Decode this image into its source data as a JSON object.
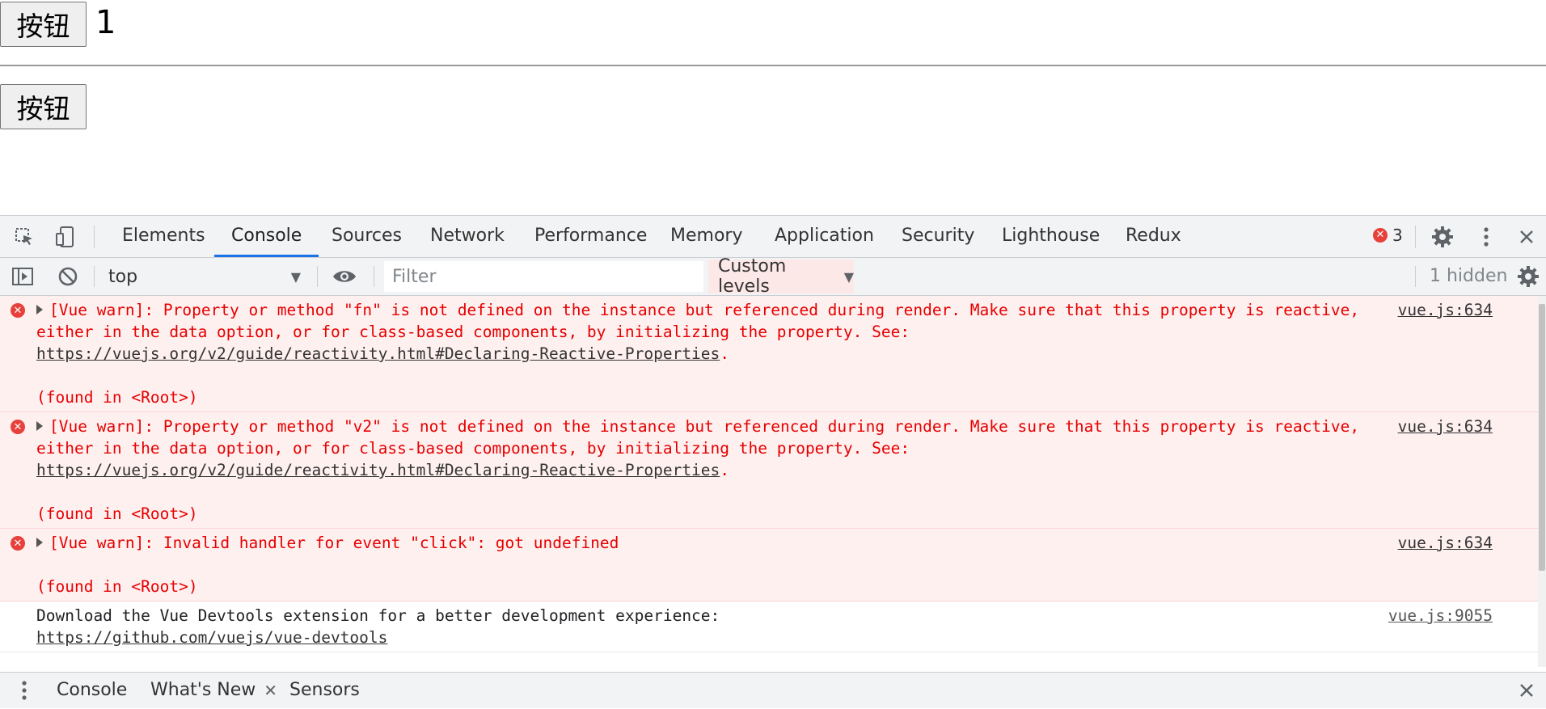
{
  "page": {
    "button1_label": "按钮",
    "value_text": "1",
    "button2_label": "按钮"
  },
  "devtools": {
    "tabs": [
      {
        "label": "Elements"
      },
      {
        "label": "Console"
      },
      {
        "label": "Sources"
      },
      {
        "label": "Network"
      },
      {
        "label": "Performance"
      },
      {
        "label": "Memory"
      },
      {
        "label": "Application"
      },
      {
        "label": "Security"
      },
      {
        "label": "Lighthouse"
      },
      {
        "label": "Redux"
      }
    ],
    "active_tab": "Console",
    "error_count": "3",
    "accent_color": "#1a73e8",
    "error_color": "#e60000"
  },
  "console_toolbar": {
    "context": "top",
    "filter_placeholder": "Filter",
    "levels_label": "Custom levels",
    "hidden_label": "1 hidden"
  },
  "messages": [
    {
      "level": "error",
      "text": "[Vue warn]: Property or method \"fn\" is not defined on the instance but referenced during render. Make sure that this property is reactive, either in the data option, or for class-based components, by initializing the property. See: ",
      "link": "https://vuejs.org/v2/guide/reactivity.html#Declaring-Reactive-Properties",
      "link_trail": ".",
      "found": "(found in <Root>)",
      "source": "vue.js:634"
    },
    {
      "level": "error",
      "text": "[Vue warn]: Property or method \"v2\" is not defined on the instance but referenced during render. Make sure that this property is reactive, either in the data option, or for class-based components, by initializing the property. See: ",
      "link": "https://vuejs.org/v2/guide/reactivity.html#Declaring-Reactive-Properties",
      "link_trail": ".",
      "found": "(found in <Root>)",
      "source": "vue.js:634"
    },
    {
      "level": "error",
      "text": "[Vue warn]: Invalid handler for event \"click\": got undefined",
      "found": "(found in <Root>)",
      "source": "vue.js:634"
    },
    {
      "level": "info",
      "text": "Download the Vue Devtools extension for a better development experience:",
      "link": "https://github.com/vuejs/vue-devtools",
      "source": "vue.js:9055"
    }
  ],
  "drawer": {
    "tabs": [
      {
        "label": "Console"
      },
      {
        "label": "What's New"
      },
      {
        "label": "Sensors"
      }
    ]
  }
}
